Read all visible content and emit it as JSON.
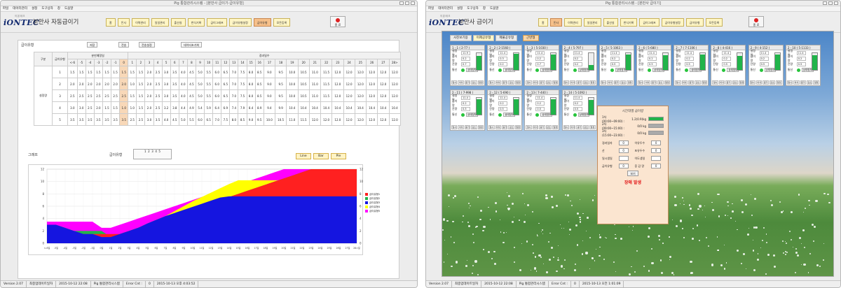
{
  "left_window": {
    "title": "Pig 통합관리시스템 - [분만사 급이기-급이유형]",
    "menu": [
      "파일",
      "데이터관리",
      "설정",
      "도구상자",
      "창",
      "도움말"
    ],
    "logo": {
      "top_text": "이온테크",
      "main": "iONTEC"
    },
    "app_title": "분만사 자동급이기",
    "nav": [
      "홈",
      "돈사",
      "이력관리",
      "일일관리",
      "출산실",
      "번식기록",
      "급이그래프",
      "급이유형설정",
      "급이유형",
      "모돈등록"
    ],
    "nav_active": 8,
    "exit_label": "종 료",
    "section_feed_type": "급이유형",
    "buttons": {
      "save": "저장",
      "print": "전송",
      "print_setting": "전송설정",
      "init_data": "데이터초기화"
    },
    "table": {
      "header_group": "구분",
      "col_type": "급이유형",
      "group_day_before": "분만예정일",
      "group_days_after": "경과일수",
      "day_cols": [
        "<-6",
        "-5",
        "-4",
        "-3",
        "-2",
        "-1",
        "0",
        "1",
        "2",
        "3",
        "4",
        "5",
        "6",
        "7",
        "8",
        "9",
        "10",
        "11",
        "12",
        "13",
        "14",
        "15",
        "16",
        "17",
        "18",
        "19",
        "20",
        "21",
        "22",
        "23",
        "24",
        "25",
        "26",
        "27",
        "28>"
      ],
      "row_group": "설정량",
      "rows": [
        {
          "type": "1",
          "values": [
            "1.5",
            "1.5",
            "1.5",
            "1.5",
            "1.5",
            "1.5",
            "1.5",
            "1.5",
            "1.5",
            "2.0",
            "2.5",
            "3.0",
            "3.5",
            "4.0",
            "4.5",
            "5.0",
            "5.5",
            "6.0",
            "6.5",
            "7.0",
            "7.5",
            "8.0",
            "8.5",
            "9.0",
            "9.5",
            "10.0",
            "10.5",
            "11.0",
            "11.5",
            "12.0",
            "12.0",
            "12.0",
            "12.0",
            "12.0",
            "12.0"
          ]
        },
        {
          "type": "2",
          "values": [
            "2.0",
            "2.0",
            "2.0",
            "2.0",
            "2.0",
            "2.0",
            "2.0",
            "1.0",
            "1.5",
            "2.0",
            "2.5",
            "3.0",
            "3.5",
            "4.0",
            "4.5",
            "5.0",
            "5.5",
            "6.0",
            "6.5",
            "7.0",
            "7.5",
            "8.0",
            "8.5",
            "9.0",
            "9.5",
            "10.0",
            "10.5",
            "11.0",
            "11.5",
            "12.0",
            "12.0",
            "12.0",
            "12.0",
            "12.0",
            "12.0"
          ]
        },
        {
          "type": "3",
          "values": [
            "2.5",
            "2.5",
            "2.5",
            "2.5",
            "2.5",
            "2.5",
            "2.5",
            "1.5",
            "1.5",
            "2.0",
            "2.5",
            "3.0",
            "3.5",
            "4.0",
            "4.5",
            "5.0",
            "5.5",
            "6.0",
            "6.5",
            "7.0",
            "7.5",
            "8.0",
            "8.5",
            "9.0",
            "9.5",
            "10.0",
            "10.5",
            "11.0",
            "11.5",
            "12.0",
            "12.0",
            "12.0",
            "12.0",
            "12.0",
            "12.0"
          ]
        },
        {
          "type": "4",
          "values": [
            "3.0",
            "3.0",
            "2.5",
            "2.0",
            "1.5",
            "1.5",
            "1.0",
            "1.0",
            "1.5",
            "2.0",
            "2.5",
            "3.2",
            "3.8",
            "4.4",
            "4.9",
            "5.4",
            "5.9",
            "6.4",
            "6.9",
            "7.4",
            "7.9",
            "8.4",
            "8.9",
            "9.4",
            "9.9",
            "10.4",
            "10.4",
            "10.4",
            "10.4",
            "10.4",
            "10.4",
            "10.4",
            "10.4",
            "10.4",
            "10.4"
          ]
        },
        {
          "type": "5",
          "values": [
            "3.5",
            "3.5",
            "3.5",
            "3.5",
            "3.5",
            "3.5",
            "3.5",
            "2.5",
            "2.5",
            "3.0",
            "3.5",
            "4.0",
            "4.5",
            "5.0",
            "5.5",
            "6.0",
            "6.5",
            "7.0",
            "7.5",
            "8.0",
            "8.5",
            "9.0",
            "9.5",
            "10.0",
            "10.5",
            "11.0",
            "11.5",
            "12.0",
            "12.0",
            "12.0",
            "12.0",
            "12.0",
            "12.0",
            "12.0",
            "12.0"
          ]
        }
      ]
    },
    "graph_label": "그래프",
    "feed_type_label": "급이유형",
    "feed_type_numbers": [
      "1",
      "2",
      "3",
      "4",
      "5"
    ],
    "chart_buttons": {
      "line": "Line",
      "bar": "Bar",
      "pie": "Pie"
    },
    "chart_data": {
      "type": "area",
      "categories": [
        "<-6일",
        "-5일",
        "-4일",
        "-3일",
        "-2일",
        "-1일",
        "0일",
        "1일",
        "2일",
        "3일",
        "4일",
        "5일",
        "6일",
        "7일",
        "8일",
        "9일",
        "10일",
        "11일",
        "12일",
        "13일",
        "14일",
        "15일",
        "16일",
        "17일",
        "18일",
        "19일",
        "20일",
        "21일",
        "22일",
        "23일",
        "24일",
        "25일",
        "26일",
        "27일",
        "28>일"
      ],
      "ylim": [
        0,
        12
      ],
      "yticks": [
        "0",
        "2",
        "4",
        "6",
        "8",
        "10",
        "12"
      ],
      "grid": true,
      "legend_position": "right",
      "series": [
        {
          "name": "급이유형1",
          "color": "#ff2020",
          "values": [
            1.5,
            1.5,
            1.5,
            1.5,
            1.5,
            1.5,
            1.5,
            1.5,
            1.5,
            2.0,
            2.5,
            3.0,
            3.5,
            4.0,
            4.5,
            5.0,
            5.5,
            6.0,
            6.5,
            7.0,
            7.5,
            8.0,
            8.5,
            9.0,
            9.5,
            10.0,
            10.5,
            11.0,
            11.5,
            12.0,
            12.0,
            12.0,
            12.0,
            12.0,
            12.0
          ]
        },
        {
          "name": "급이유형2",
          "color": "#21b44a",
          "values": [
            2.0,
            2.0,
            2.0,
            2.0,
            2.0,
            2.0,
            2.0,
            1.0,
            1.5,
            2.0,
            2.5,
            3.0,
            3.5,
            4.0,
            4.5,
            5.0,
            5.5,
            6.0,
            6.5,
            7.0,
            7.5,
            8.0,
            8.5,
            9.0,
            9.5,
            10.0,
            10.5,
            11.0,
            11.5,
            12.0,
            12.0,
            12.0,
            12.0,
            12.0,
            12.0
          ]
        },
        {
          "name": "급이유형3",
          "color": "#1515e0",
          "values": [
            3.0,
            3.0,
            2.5,
            2.0,
            1.5,
            1.5,
            1.0,
            1.0,
            1.5,
            2.0,
            2.5,
            3.2,
            3.8,
            4.4,
            4.9,
            5.4,
            5.9,
            6.4,
            6.9,
            7.4,
            7.6,
            7.6,
            7.6,
            7.6,
            7.6,
            7.6,
            7.6,
            7.6,
            7.6,
            7.6,
            7.6,
            7.6,
            7.6,
            7.6,
            7.6
          ]
        },
        {
          "name": "급이유형4",
          "color": "#ffff00",
          "values": [
            3.0,
            3.0,
            2.5,
            2.0,
            1.5,
            1.5,
            1.0,
            1.0,
            1.5,
            2.0,
            2.5,
            3.2,
            3.8,
            4.4,
            5.2,
            6.0,
            6.8,
            7.5,
            8.2,
            8.9,
            9.6,
            10.2,
            10.2,
            10.2,
            10.2,
            10.2,
            10.2,
            10.2,
            10.2,
            10.2,
            10.2,
            10.2,
            10.2,
            10.2,
            10.2
          ]
        },
        {
          "name": "급이유형5",
          "color": "#ff00ff",
          "values": [
            3.5,
            3.5,
            3.5,
            3.5,
            3.5,
            3.5,
            2.5,
            2.5,
            3.0,
            3.5,
            4.0,
            4.5,
            5.0,
            5.5,
            6.0,
            6.5,
            7.0,
            7.5,
            8.0,
            8.5,
            9.0,
            9.5,
            10.0,
            10.5,
            11.0,
            11.5,
            12.0,
            12.0,
            12.0,
            12.0,
            12.0,
            12.0,
            12.0,
            12.0,
            12.0
          ]
        }
      ]
    },
    "status": [
      "Version 2.07",
      "최종업데이트일자",
      "2015-10-12 22:08",
      "Pig 통합관리시스템",
      "Error Cnt :",
      "0",
      "2015-10-13 오후 4:03:52"
    ]
  },
  "right_window": {
    "title": "Pig 통합관리시스템 - [분만사 급이기]",
    "menu": [
      "파일",
      "데이터관리",
      "설정",
      "도구상자",
      "창",
      "도움말"
    ],
    "logo": {
      "top_text": "이온테크",
      "main": "iONTEC"
    },
    "app_title": "분만사 급이기",
    "nav": [
      "홈",
      "돈사",
      "이력관리",
      "일일관리",
      "출산실",
      "번식기록",
      "급이그래프",
      "급이유형설정",
      "급이유형",
      "모돈등록"
    ],
    "nav_active": 1,
    "exit_label": "종 료",
    "tabs": [
      "사진보기용",
      "이제공유형",
      "제불공유형",
      "근반형"
    ],
    "tab_active": 1,
    "cards": [
      {
        "id": "1 - 1 ( 2-77 )",
        "a": "11.9",
        "b": "0.2",
        "c": "0.7",
        "fill": 0.85,
        "status": "상태정보"
      },
      {
        "id": "2 - 2 ( 2-1560 )",
        "a": "11.4",
        "b": "0.3",
        "c": "0.2",
        "fill": 0.95,
        "status": "상태정보"
      },
      {
        "id": "1 - 3 ( 5-1030 )",
        "a": "11.4",
        "b": "0.2",
        "c": "0.7",
        "fill": 0.92,
        "status": "상태정보"
      },
      {
        "id": "2 - 4 ( 5-797 )",
        "a": "11.4",
        "b": "0.2",
        "c": "0.2",
        "fill": 0.3,
        "status": "상태정보"
      },
      {
        "id": "2 - 5 ( 5-1063 )",
        "a": "11.4",
        "b": "0.2",
        "c": "0.5",
        "fill": 0.9,
        "status": "상태정보"
      },
      {
        "id": "2 - 6 ( 5-680 )",
        "a": "11.4",
        "b": "0.2",
        "c": "0.5",
        "fill": 0.88,
        "status": "상태정보"
      },
      {
        "id": "2 - 7 ( 7-1106 )",
        "a": "11.4",
        "b": "0.2",
        "c": "0.5",
        "fill": 0.9,
        "status": "상태정보"
      },
      {
        "id": "2 - 8 ( 4-416 )",
        "a": "11.4",
        "b": "0.2",
        "c": "0.5",
        "fill": 0.85,
        "status": "상태정보"
      },
      {
        "id": "2 - 9 ( 4-152 )",
        "a": "11.4",
        "b": "0.2",
        "c": "0.5",
        "fill": 0.92,
        "status": "상태정보"
      },
      {
        "id": "2 - 10 ( 5-1133 )",
        "a": "11.4",
        "b": "0.2",
        "c": "0.5",
        "fill": 0.88,
        "status": "상태정보"
      },
      {
        "id": "2 - 11 ( 7-998 )",
        "a": "11.4",
        "b": "0.2",
        "c": "0.5",
        "fill": 0.9,
        "status": "상태정보"
      },
      {
        "id": "2 - 12 ( 5-690 )",
        "a": "11.4",
        "b": "0.2",
        "c": "0.5",
        "fill": 0.92,
        "status": "상태정보"
      },
      {
        "id": "2 - 13 ( 7-440 )",
        "a": "11.4",
        "b": "0.2",
        "c": "0.5",
        "fill": 0.9,
        "status": "상태정보"
      },
      {
        "id": "2 - 14 ( 5-1092 )",
        "a": "11.4",
        "b": "0.2",
        "c": "0.5",
        "fill": 0.88,
        "status": "상태정보"
      }
    ],
    "card_labels": {
      "a": "설정량",
      "b": "급이량",
      "c": "잔량",
      "comm": "통신"
    },
    "card_footer": [
      "일시",
      "이삭",
      "증가",
      "감소",
      "일정"
    ],
    "popup": {
      "title": "시간대별 급이량",
      "slots": [
        {
          "label": "1차(00:00~09:00) :",
          "value": "1.2(0.9)kg",
          "color": "#21b44a"
        },
        {
          "label": "2차(09:00~15:00) :",
          "value": "0/0 kg",
          "color": "#aaaaaa"
        },
        {
          "label": "3차(15:00~23:00) :",
          "value": "0/0 kg",
          "color": "#aaaaaa"
        }
      ],
      "fields": [
        {
          "l": "경과일자",
          "v": "0"
        },
        {
          "l": "이유두수",
          "v": "0"
        },
        {
          "l": "산",
          "v": "0"
        },
        {
          "l": "포유두수",
          "v": "0"
        },
        {
          "l": "일시생일",
          "v": ""
        },
        {
          "l": "이도생일",
          "v": ""
        },
        {
          "l": "급이유형",
          "v": "0"
        },
        {
          "l": "증 감 량",
          "v": "0"
        }
      ],
      "ok_label": "보기",
      "warning": "장애 발생"
    },
    "status": [
      "Version 2.07",
      "최종업데이트일자",
      "2015-10-12 22:08",
      "Pig 통합관리시스템",
      "Error Cnt :",
      "0",
      "2015-10-13 오전 1:01:09"
    ]
  }
}
